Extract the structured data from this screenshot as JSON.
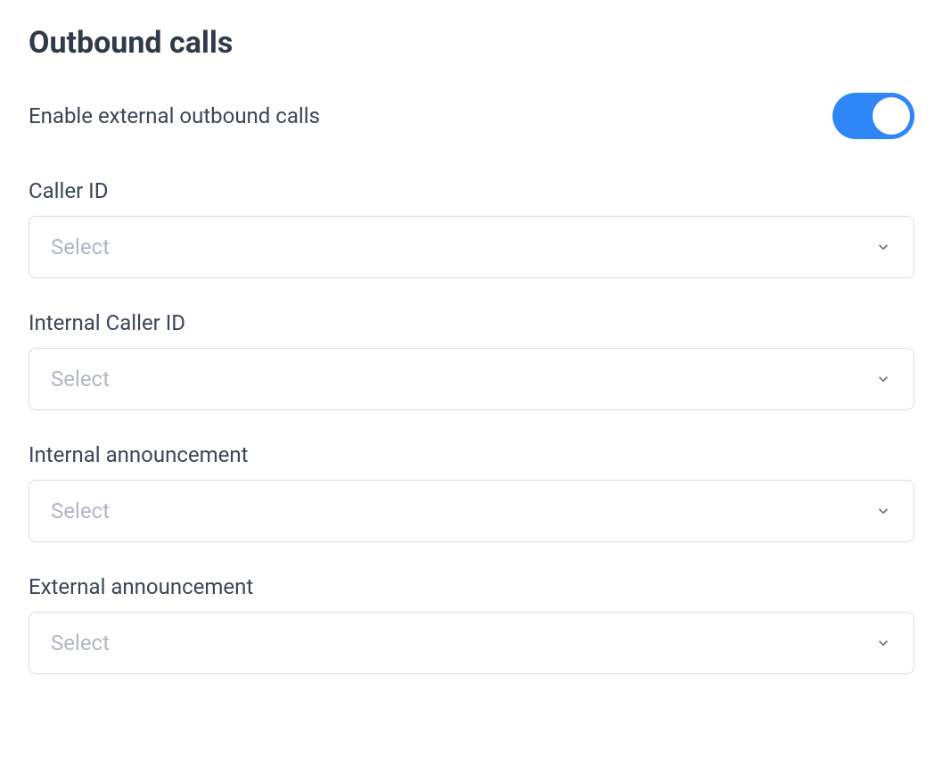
{
  "section": {
    "title": "Outbound calls"
  },
  "toggle": {
    "label": "Enable external outbound calls",
    "state": "on"
  },
  "fields": {
    "caller_id": {
      "label": "Caller ID",
      "placeholder": "Select"
    },
    "internal_caller_id": {
      "label": "Internal Caller ID",
      "placeholder": "Select"
    },
    "internal_announcement": {
      "label": "Internal announcement",
      "placeholder": "Select"
    },
    "external_announcement": {
      "label": "External announcement",
      "placeholder": "Select"
    }
  }
}
